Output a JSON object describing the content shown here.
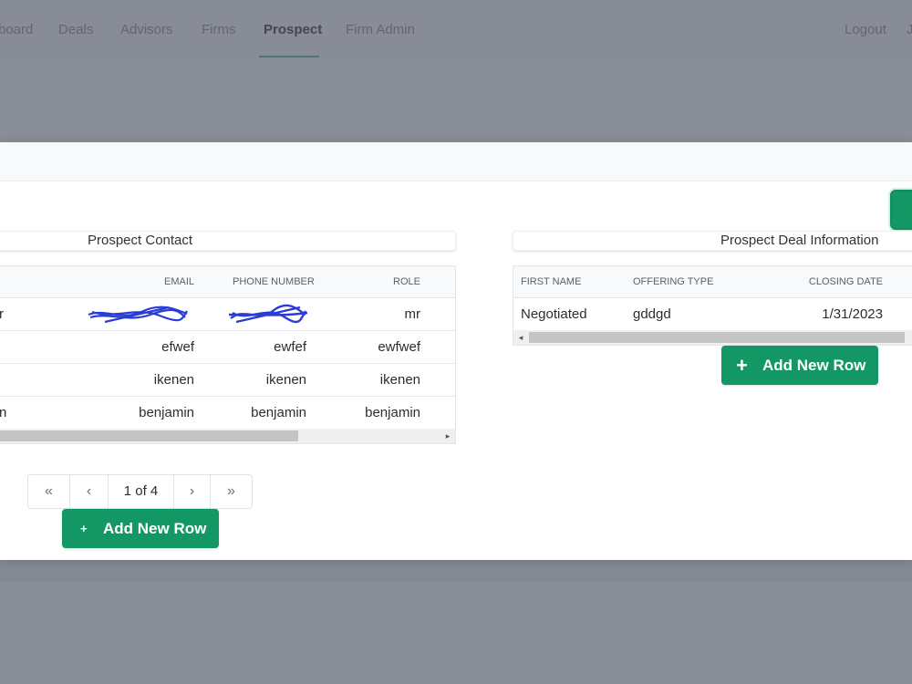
{
  "nav": {
    "items": [
      {
        "label": "board"
      },
      {
        "label": "Deals"
      },
      {
        "label": "Advisors"
      },
      {
        "label": "Firms"
      },
      {
        "label": "Prospect"
      },
      {
        "label": "Firm Admin"
      }
    ],
    "logout_label": "Logout",
    "user_initial": "J"
  },
  "contact": {
    "title": "Prospect Contact",
    "columns": [
      "EMAIL",
      "PHONE NUMBER",
      "ROLE"
    ],
    "rows": [
      {
        "first": "r",
        "email": "",
        "phone": "",
        "role": "mr"
      },
      {
        "first": "",
        "email": "efwef",
        "phone": "ewfef",
        "role": "ewfwef"
      },
      {
        "first": "",
        "email": "ikenen",
        "phone": "ikenen",
        "role": "ikenen"
      },
      {
        "first": "n",
        "email": "benjamin",
        "phone": "benjamin",
        "role": "benjamin"
      }
    ],
    "pager": {
      "first_icon": "«",
      "prev_icon": "‹",
      "info": "1 of 4",
      "next_icon": "›",
      "last_icon": "»"
    },
    "add_label": "Add New Row",
    "add_icon": "+"
  },
  "deal": {
    "title": "Prospect Deal Information",
    "columns": [
      "FIRST NAME",
      "OFFERING TYPE",
      "CLOSING DATE"
    ],
    "rows": [
      {
        "first_name": "Negotiated",
        "offering_type": "gddgd",
        "closing_date": "1/31/2023"
      }
    ],
    "add_label": "Add New Row",
    "add_icon": "+"
  },
  "colors": {
    "accent": "#139865",
    "overlay": "#8a8e98",
    "redaction": "#2a3bd6"
  }
}
